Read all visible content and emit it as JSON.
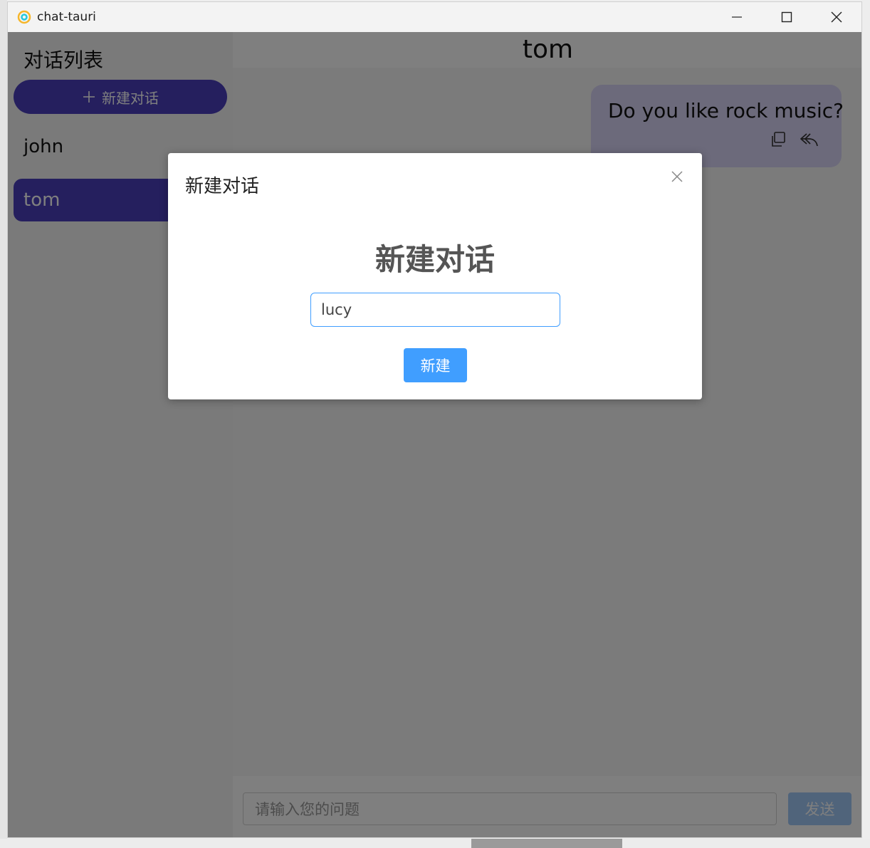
{
  "window": {
    "title": "chat-tauri"
  },
  "sidebar": {
    "title": "对话列表",
    "new_chat_label": "新建对话",
    "conversations": [
      {
        "name": "john",
        "active": false
      },
      {
        "name": "tom",
        "active": true
      }
    ]
  },
  "chat": {
    "title": "tom",
    "messages": [
      {
        "text": "Do you like rock music?"
      }
    ],
    "input_placeholder": "请输入您的问题",
    "send_label": "发送"
  },
  "modal": {
    "header": "新建对话",
    "heading": "新建对话",
    "input_value": "lucy",
    "create_label": "新建"
  },
  "colors": {
    "accent": "#4a3fbd",
    "primary_button": "#409eff",
    "message_bubble": "#d9d5f6"
  }
}
